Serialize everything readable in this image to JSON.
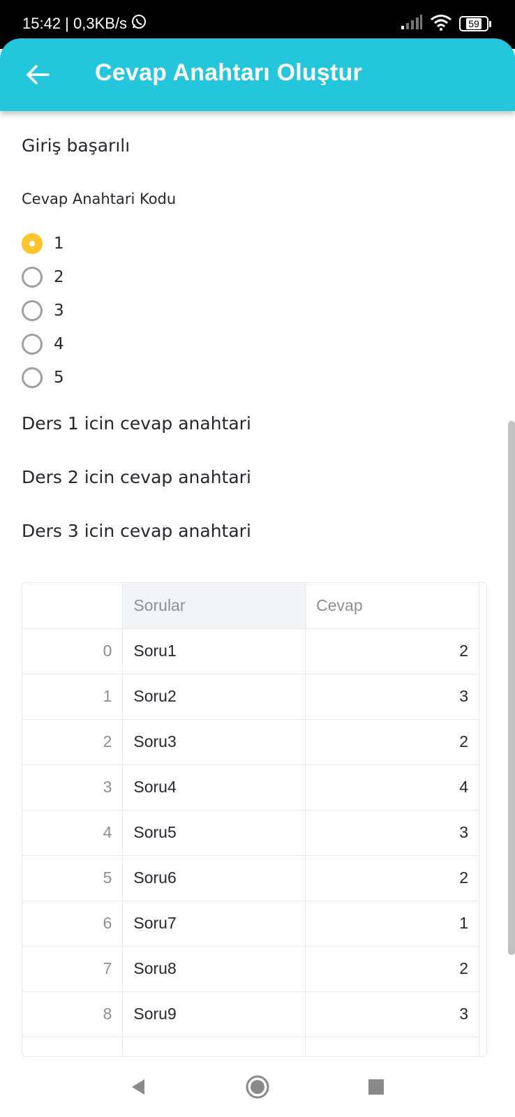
{
  "status_bar": {
    "time_speed": "15:42 | 0,3KB/s",
    "battery": "59"
  },
  "app_bar": {
    "title": "Cevap Anahtarı Oluştur"
  },
  "content": {
    "success_message": "Giriş başarılı",
    "radio_label": "Cevap Anahtari Kodu",
    "radio_options": [
      "1",
      "2",
      "3",
      "4",
      "5"
    ],
    "selected_option": "1",
    "ders_links": [
      "Ders 1 icin cevap anahtari",
      "Ders 2 icin cevap anahtari",
      "Ders 3 icin cevap anahtari"
    ]
  },
  "table": {
    "columns": [
      "",
      "Sorular",
      "Cevap"
    ],
    "rows": [
      {
        "index": "0",
        "sorular": "Soru1",
        "cevap": "2"
      },
      {
        "index": "1",
        "sorular": "Soru2",
        "cevap": "3"
      },
      {
        "index": "2",
        "sorular": "Soru3",
        "cevap": "2"
      },
      {
        "index": "3",
        "sorular": "Soru4",
        "cevap": "4"
      },
      {
        "index": "4",
        "sorular": "Soru5",
        "cevap": "3"
      },
      {
        "index": "5",
        "sorular": "Soru6",
        "cevap": "2"
      },
      {
        "index": "6",
        "sorular": "Soru7",
        "cevap": "1"
      },
      {
        "index": "7",
        "sorular": "Soru8",
        "cevap": "2"
      },
      {
        "index": "8",
        "sorular": "Soru9",
        "cevap": "3"
      },
      {
        "index": "",
        "sorular": "",
        "cevap": ""
      }
    ]
  },
  "colors": {
    "app_bar": "#24c6dc",
    "radio_selected": "#ffc52c",
    "text": "#262730",
    "muted": "#8d8f96"
  },
  "icons": {
    "back": "arrow-left-icon",
    "whatsapp": "whatsapp-icon",
    "signal": "signal-icon",
    "wifi": "wifi-icon",
    "battery": "battery-icon",
    "nav_back": "triangle-back-icon",
    "nav_home": "circle-home-icon",
    "nav_recents": "square-recents-icon"
  }
}
